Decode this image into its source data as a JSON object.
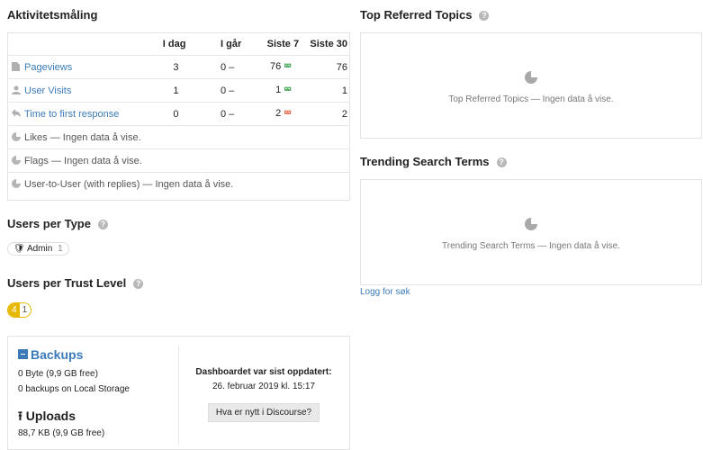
{
  "activity": {
    "title": "Aktivitetsmåling",
    "headers": [
      "",
      "I dag",
      "I går",
      "Siste 7",
      "Siste 30"
    ],
    "rows": [
      {
        "label": "Pageviews",
        "today": "3",
        "yesterday": "0 –",
        "last7": "76",
        "last7_trend": "up",
        "last30": "76"
      },
      {
        "label": "User Visits",
        "today": "1",
        "yesterday": "0 –",
        "last7": "1",
        "last7_trend": "up",
        "last30": "1"
      },
      {
        "label": "Time to first response",
        "today": "0",
        "yesterday": "0 –",
        "last7": "2",
        "last7_trend": "down",
        "last30": "2"
      }
    ],
    "empty_rows": [
      "Likes — Ingen data å vise.",
      "Flags — Ingen data å vise.",
      "User-to-User (with replies) — Ingen data å vise."
    ]
  },
  "users_per_type": {
    "title": "Users per Type",
    "badge_label": "Admin",
    "badge_count": "1"
  },
  "users_per_trust": {
    "title": "Users per Trust Level",
    "levels": [
      "4",
      "1"
    ]
  },
  "backups": {
    "title": "Backups",
    "line1": "0 Byte (9,9 GB free)",
    "line2": "0 backups on Local Storage"
  },
  "uploads": {
    "title": "Uploads",
    "line1": "88,7 KB (9,9 GB free)"
  },
  "dashboard": {
    "updated_label": "Dashboardet var sist oppdatert:",
    "updated_value": "26. februar 2019 kl. 15:17",
    "whats_new_button": "Hva er nytt i Discourse?"
  },
  "top_referred": {
    "title": "Top Referred Topics",
    "empty_text": "Top Referred Topics — Ingen data å vise."
  },
  "trending": {
    "title": "Trending Search Terms",
    "empty_text": "Trending Search Terms — Ingen data å vise.",
    "log_link": "Logg for søk"
  },
  "colors": {
    "link": "#3a7bb8",
    "up": "#2b9a3f",
    "down": "#e45735",
    "trust_badge": "#e6b800"
  }
}
